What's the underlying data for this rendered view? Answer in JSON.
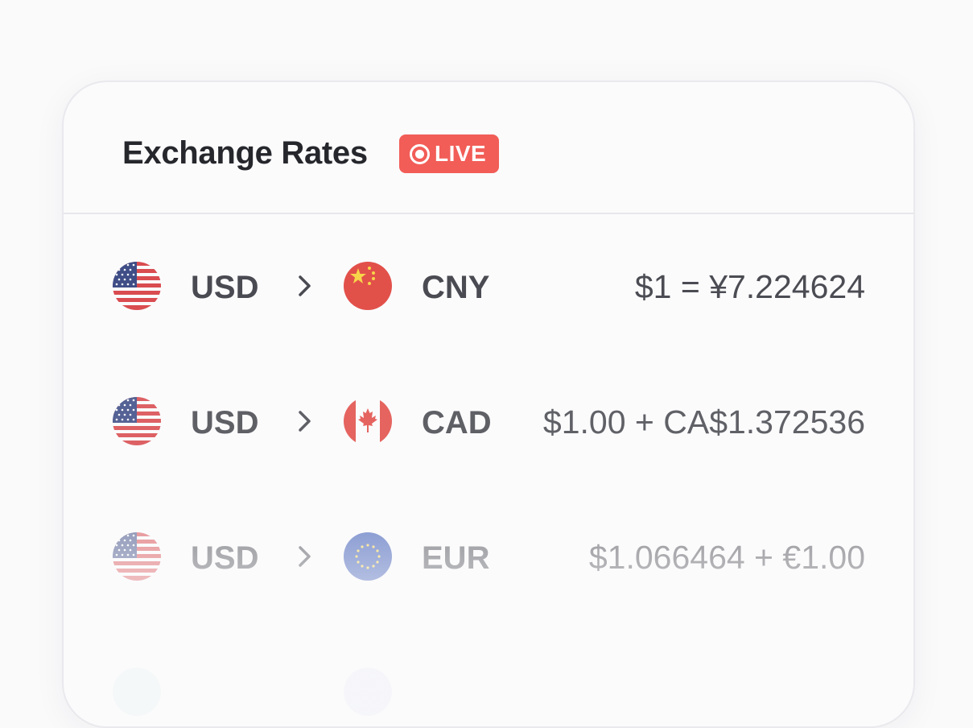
{
  "card": {
    "title": "Exchange Rates",
    "badge_label": "LIVE",
    "badge_color": "#f25d57"
  },
  "rates": [
    {
      "from_code": "USD",
      "to_code": "CNY",
      "from_flag": "us-flag-icon",
      "to_flag": "cn-flag-icon",
      "rate_text": "$1 = ¥7.224624"
    },
    {
      "from_code": "USD",
      "to_code": "CAD",
      "from_flag": "us-flag-icon",
      "to_flag": "ca-flag-icon",
      "rate_text": "$1.00 + CA$1.372536"
    },
    {
      "from_code": "USD",
      "to_code": "EUR",
      "from_flag": "us-flag-icon",
      "to_flag": "eu-flag-icon",
      "rate_text": "$1.066464 + €1.00"
    }
  ]
}
